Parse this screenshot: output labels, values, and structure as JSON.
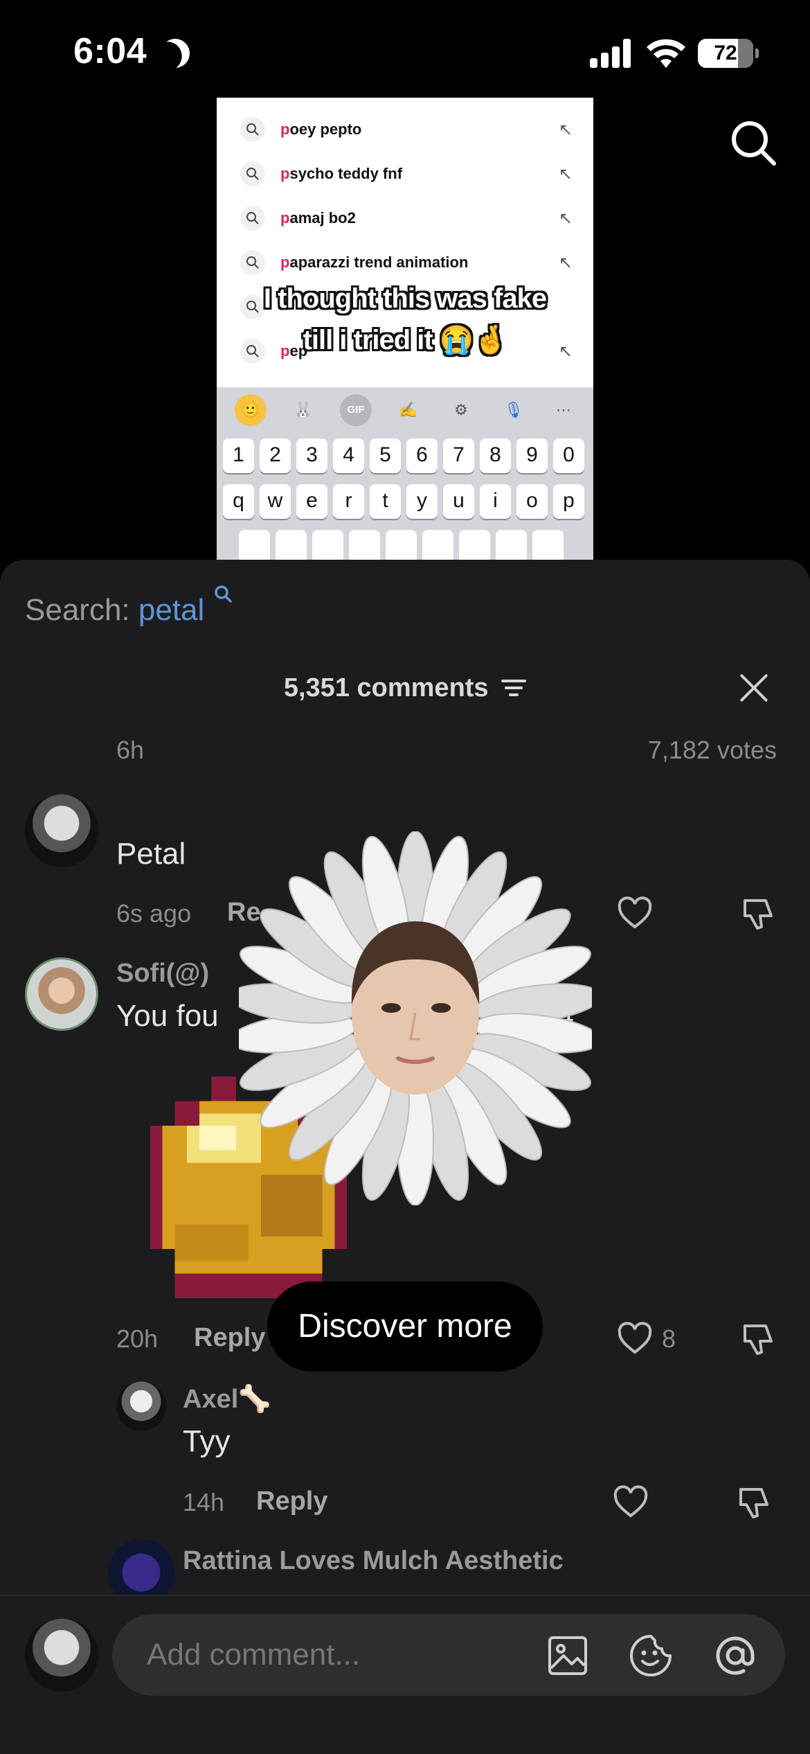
{
  "status_bar": {
    "time": "6:04",
    "battery": "72"
  },
  "video": {
    "suggestions": [
      {
        "prefix": "p",
        "rest": "oey pepto"
      },
      {
        "prefix": "p",
        "rest": "sycho teddy fnf"
      },
      {
        "prefix": "p",
        "rest": "amaj bo2"
      },
      {
        "prefix": "p",
        "rest": "aparazzi trend animation"
      },
      {
        "prefix": "",
        "rest": ""
      },
      {
        "prefix": "p",
        "rest": "ep"
      }
    ],
    "caption_line1": "I thought this was fake",
    "caption_line2": "till i tried it 😭🤞",
    "keyboard_numbers": [
      "1",
      "2",
      "3",
      "4",
      "5",
      "6",
      "7",
      "8",
      "9",
      "0"
    ],
    "keyboard_letters": [
      "q",
      "w",
      "e",
      "r",
      "t",
      "y",
      "u",
      "i",
      "o",
      "p"
    ],
    "keyboard_toolbar": [
      "🙂",
      "🐰",
      "GIF",
      "✍",
      "⚙",
      "🎙",
      "⋯"
    ]
  },
  "comments_panel": {
    "search_label": "Search: ",
    "search_keyword": "petal",
    "count_label": "5,351 comments",
    "comments": [
      {
        "time": "6h",
        "votes": "7,182 votes"
      },
      {
        "text": "Petal",
        "time": "6s ago",
        "reply_label": "Re"
      },
      {
        "username": "Sofi(@)",
        "text": "You fou",
        "suffix": "/4"
      },
      {
        "time": "20h",
        "reply_label": "Reply",
        "likes": "8"
      },
      {
        "username": "Axel🦴",
        "text": "Tyy",
        "time": "14h",
        "reply_label": "Reply"
      },
      {
        "username": "Rattina Loves Mulch Aesthetic"
      }
    ]
  },
  "discover_label": "Discover more",
  "comment_input": {
    "placeholder": "Add comment..."
  }
}
